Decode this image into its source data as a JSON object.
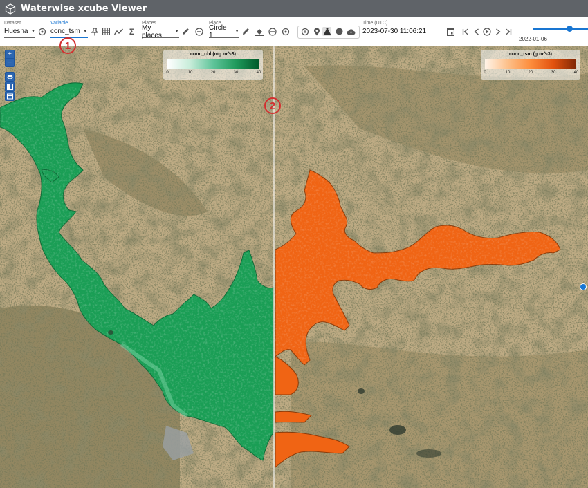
{
  "app": {
    "title": "Waterwise xcube Viewer"
  },
  "toolbar": {
    "dataset": {
      "label": "Dataset",
      "value": "Huesna"
    },
    "variable": {
      "label": "Variable",
      "value": "conc_tsm"
    },
    "places": {
      "label": "Places",
      "value": "My places"
    },
    "place": {
      "label": "Place",
      "value": "Circle 1"
    },
    "time": {
      "label": "Time (UTC)",
      "value": "2023-07-30 11:06:21"
    },
    "slider": {
      "date": "2022-01-06",
      "position_fraction": 0.67
    }
  },
  "map": {
    "legend_left": {
      "title": "conc_chl (mg m^-3)",
      "ticks": [
        "0",
        "10",
        "20",
        "30",
        "40"
      ],
      "colors": [
        "#ffffff",
        "#c7ecd9",
        "#5fc49a",
        "#1f9a5c",
        "#005a2a"
      ]
    },
    "legend_right": {
      "title": "conc_tsm (g m^-3)",
      "ticks": [
        "0",
        "10",
        "20",
        "30",
        "40"
      ],
      "colors": [
        "#fff4e8",
        "#fdc08a",
        "#fd8d3c",
        "#e2520f",
        "#7f2704"
      ]
    },
    "markers": [
      "1",
      "2"
    ],
    "water_colors": {
      "chl": "#1a9e55",
      "tsm": "#f06414"
    }
  }
}
